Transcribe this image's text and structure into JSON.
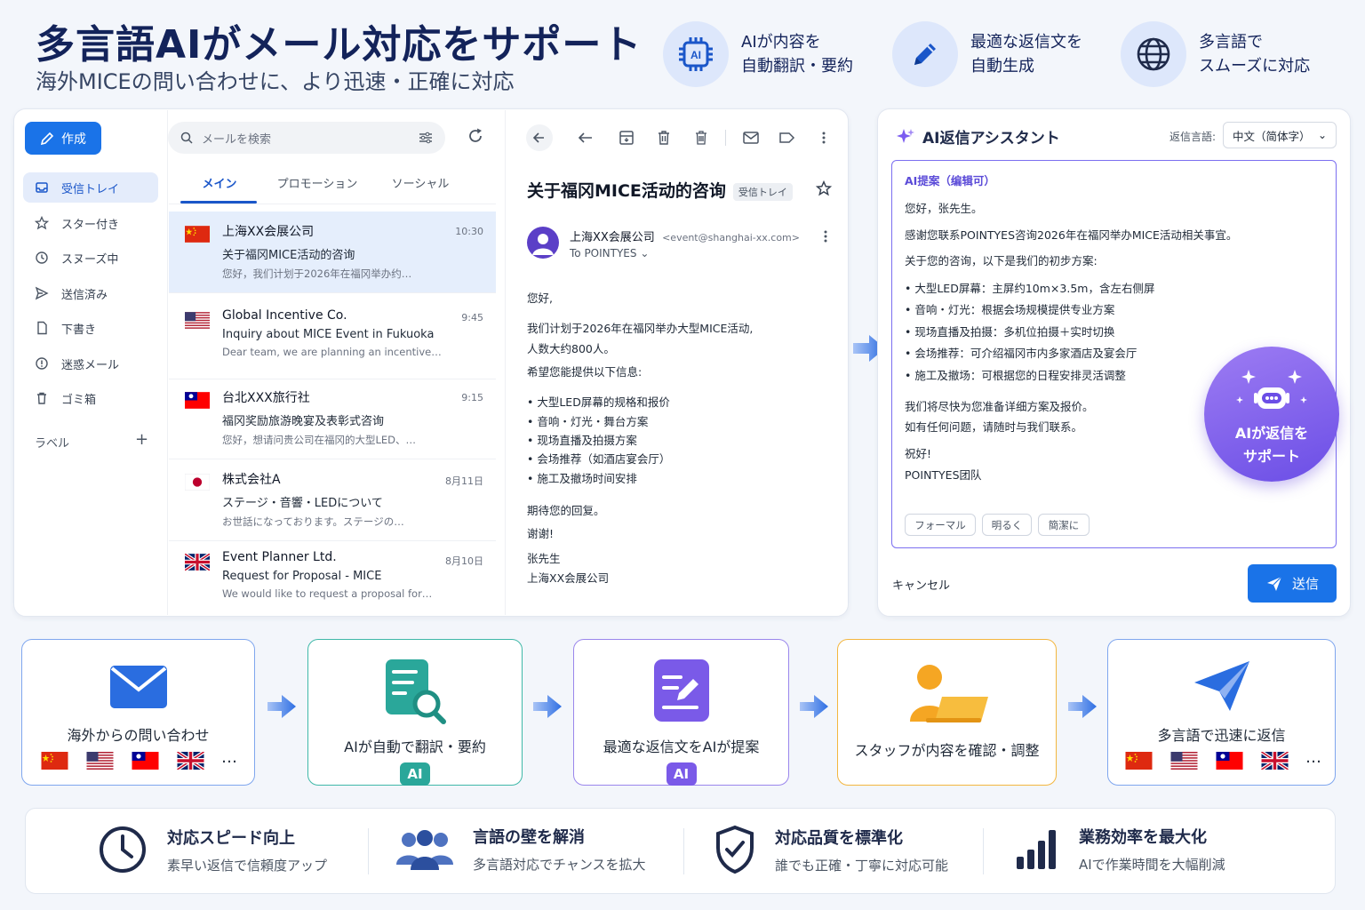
{
  "header": {
    "title": "多言語AIがメール対応をサポート",
    "subtitle": "海外MICEの問い合わせに、より迅速・正確に対応",
    "features": [
      {
        "icon": "ai-chip-icon",
        "line1": "AIが内容を",
        "line2": "自動翻訳・要約"
      },
      {
        "icon": "pencil-icon",
        "line1": "最適な返信文を",
        "line2": "自動生成"
      },
      {
        "icon": "globe-icon",
        "line1": "多言語で",
        "line2": "スムーズに対応"
      }
    ]
  },
  "mail": {
    "compose_label": "作成",
    "nav": [
      {
        "label": "受信トレイ",
        "icon": "inbox-icon",
        "active": true
      },
      {
        "label": "スター付き",
        "icon": "star-icon"
      },
      {
        "label": "スヌーズ中",
        "icon": "clock-icon"
      },
      {
        "label": "送信済み",
        "icon": "send-icon"
      },
      {
        "label": "下書き",
        "icon": "draft-icon"
      },
      {
        "label": "迷惑メール",
        "icon": "spam-icon"
      },
      {
        "label": "ゴミ箱",
        "icon": "trash-icon"
      }
    ],
    "labels_heading": "ラベル",
    "search_placeholder": "メールを検索",
    "tabs": [
      "メイン",
      "プロモーション",
      "ソーシャル"
    ],
    "list": [
      {
        "flag": "cn",
        "from": "上海XX会展公司",
        "time": "10:30",
        "subject": "关于福冈MICE活动的咨询",
        "preview": "您好，我们计划于2026年在福冈举办约…"
      },
      {
        "flag": "us",
        "from": "Global Incentive Co.",
        "time": "9:45",
        "subject": "Inquiry about MICE Event in Fukuoka",
        "preview": "Dear team, we are planning an incentive…"
      },
      {
        "flag": "tw",
        "from": "台北XXX旅行社",
        "time": "9:15",
        "subject": "福冈奖励旅游晚宴及表彰式咨询",
        "preview": "您好，想请问贵公司在福冈的大型LED、…"
      },
      {
        "flag": "jp",
        "from": "株式会社A",
        "time": "8月11日",
        "subject": "ステージ・音響・LEDについて",
        "preview": "お世話になっております。ステージの…"
      },
      {
        "flag": "gb",
        "from": "Event Planner Ltd.",
        "time": "8月10日",
        "subject": "Request for Proposal - MICE",
        "preview": "We would like to request a proposal for…"
      }
    ],
    "message": {
      "title": "关于福冈MICE活动的咨询",
      "badge": "受信トレイ",
      "sender": "上海XX会展公司",
      "sender_email": "<event@shanghai-xx.com>",
      "to": "To POINTYES",
      "lines": [
        "您好,",
        "我们计划于2026年在福冈举办大型MICE活动,",
        "人数大约800人。",
        "希望您能提供以下信息:",
        "•  大型LED屏幕的规格和报价",
        "•  音响・灯光・舞台方案",
        "•  现场直播及拍摄方案",
        "•  会场推荐（如酒店宴会厅）",
        "•  施工及撤场时间安排",
        "期待您的回复。",
        "谢谢!",
        "张先生",
        "上海XX会展公司"
      ]
    }
  },
  "ai": {
    "title": "AI返信アシスタント",
    "lang_label": "返信言語:",
    "lang_value": "中文（简体字）",
    "suggest_label": "AI提案（编辑可）",
    "lines": [
      "您好，张先生。",
      "感谢您联系POINTYES咨询2026年在福冈举办MICE活动相关事宜。",
      "关于您的咨询，以下是我们的初步方案:",
      "•  大型LED屏幕：主屏约10m×3.5m，含左右侧屏",
      "•  音响・灯光：根据会场规模提供专业方案",
      "•  现场直播及拍摄：多机位拍摄＋实时切换",
      "•  会场推荐：可介绍福冈市内多家酒店及宴会厅",
      "•  施工及撤场：可根据您的日程安排灵活调整",
      "我们将尽快为您准备详细方案及报价。",
      "如有任何问题，请随时与我们联系。",
      "祝好!",
      "POINTYES团队"
    ],
    "chips": [
      "フォーマル",
      "明るく",
      "簡潔に"
    ],
    "bot_line1": "AIが返信を",
    "bot_line2": "サポート",
    "cancel": "キャンセル",
    "send": "送信"
  },
  "flow": [
    {
      "label": "海外からの問い合わせ",
      "color": "#7fa6ee"
    },
    {
      "label": "AIが自動で翻訳・要約",
      "color": "#3fb8a8",
      "tag": "AI"
    },
    {
      "label": "最適な返信文をAIが提案",
      "color": "#9a86ec",
      "tag": "AI"
    },
    {
      "label": "スタッフが内容を確認・調整",
      "color": "#f3b63f"
    },
    {
      "label": "多言語で迅速に返信",
      "color": "#7fa6ee"
    }
  ],
  "flags_more": "…",
  "benefits": [
    {
      "icon": "clock-icon",
      "title": "対応スピード向上",
      "sub": "素早い返信で信頼度アップ"
    },
    {
      "icon": "people-icon",
      "title": "言語の壁を解消",
      "sub": "多言語対応でチャンスを拡大"
    },
    {
      "icon": "shield-check-icon",
      "title": "対応品質を標準化",
      "sub": "誰でも正確・丁寧に対応可能"
    },
    {
      "icon": "bar-chart-icon",
      "title": "業務効率を最大化",
      "sub": "AIで作業時間を大幅削減"
    }
  ]
}
